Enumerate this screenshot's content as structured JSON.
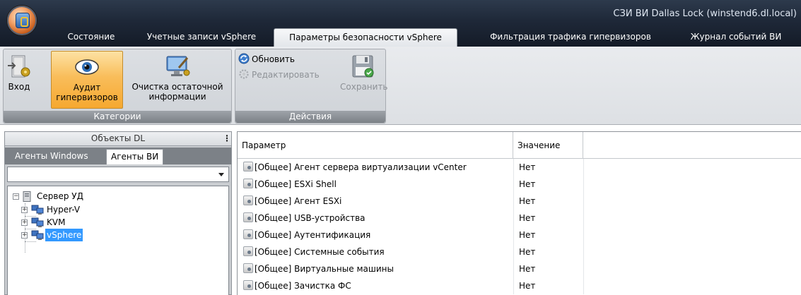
{
  "window": {
    "title": "СЗИ ВИ Dallas Lock (winstend6.dl.local)"
  },
  "tabs": [
    {
      "label": "Состояние"
    },
    {
      "label": "Учетные записи vSphere"
    },
    {
      "label": "Параметры безопасности vSphere",
      "active": true
    },
    {
      "label": "Фильтрация трафика гипервизоров"
    },
    {
      "label": "Журнал событий ВИ"
    }
  ],
  "ribbon": {
    "categories": {
      "caption": "Категории",
      "login_label": "Вход",
      "audit_label_1": "Аудит",
      "audit_label_2": "гипервизоров",
      "cleanup_label_1": "Очистка остаточной",
      "cleanup_label_2": "информации"
    },
    "actions": {
      "caption": "Действия",
      "refresh_label": "Обновить",
      "edit_label": "Редактировать",
      "save_label": "Сохранить"
    }
  },
  "left_panel": {
    "header": "Объекты DL",
    "tabs": [
      {
        "label": "Агенты Windows"
      },
      {
        "label": "Агенты ВИ",
        "active": true
      }
    ],
    "select_value": "",
    "tree": {
      "root": "Сервер УД",
      "children": [
        "Hyper-V",
        "KVM",
        "vSphere"
      ],
      "selected": "vSphere"
    }
  },
  "grid": {
    "columns": [
      "Параметр",
      "Значение"
    ],
    "rows": [
      {
        "param": "[Общее] Агент сервера виртуализации vCenter",
        "value": "Нет"
      },
      {
        "param": "[Общее] ESXi Shell",
        "value": "Нет"
      },
      {
        "param": "[Общее] Агент ESXi",
        "value": "Нет"
      },
      {
        "param": "[Общее] USB-устройства",
        "value": "Нет"
      },
      {
        "param": "[Общее] Аутентификация",
        "value": "Нет"
      },
      {
        "param": "[Общее] Системные события",
        "value": "Нет"
      },
      {
        "param": "[Общее] Виртуальные машины",
        "value": "Нет"
      },
      {
        "param": "[Общее] Зачистка ФС",
        "value": "Нет"
      }
    ]
  },
  "colors": {
    "titlebar": "#1e2838",
    "selection": "#3399ff",
    "pressed_button": "#f9bd5a"
  },
  "icons": {
    "app": "app-orb-icon",
    "login": "login-door-icon",
    "audit": "eye-icon",
    "cleanup": "monitor-brush-icon",
    "refresh": "refresh-icon",
    "edit": "edit-gear-icon",
    "save": "floppy-disk-icon",
    "server": "server-icon",
    "network": "network-computers-icon",
    "parameter": "parameter-gear-icon"
  }
}
